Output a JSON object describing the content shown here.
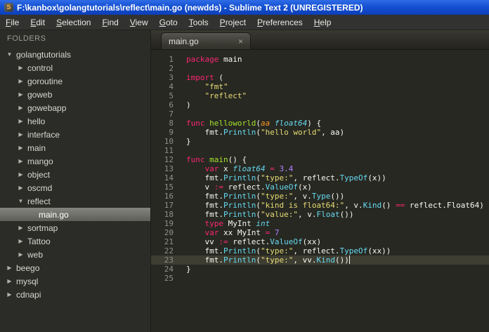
{
  "window": {
    "title": "F:\\kanbox\\golangtutorials\\reflect\\main.go (newdds) - Sublime Text 2 (UNREGISTERED)",
    "app_icon_letter": "S"
  },
  "menu": {
    "items": [
      "File",
      "Edit",
      "Selection",
      "Find",
      "View",
      "Goto",
      "Tools",
      "Project",
      "Preferences",
      "Help"
    ]
  },
  "sidebar": {
    "header": "FOLDERS",
    "items": [
      {
        "label": "golangtutorials",
        "lvl": 0,
        "kind": "folder",
        "state": "open"
      },
      {
        "label": "control",
        "lvl": 1,
        "kind": "folder",
        "state": "closed"
      },
      {
        "label": "goroutine",
        "lvl": 1,
        "kind": "folder",
        "state": "closed"
      },
      {
        "label": "goweb",
        "lvl": 1,
        "kind": "folder",
        "state": "closed"
      },
      {
        "label": "gowebapp",
        "lvl": 1,
        "kind": "folder",
        "state": "closed"
      },
      {
        "label": "hello",
        "lvl": 1,
        "kind": "folder",
        "state": "closed"
      },
      {
        "label": "interface",
        "lvl": 1,
        "kind": "folder",
        "state": "closed"
      },
      {
        "label": "main",
        "lvl": 1,
        "kind": "folder",
        "state": "closed"
      },
      {
        "label": "mango",
        "lvl": 1,
        "kind": "folder",
        "state": "closed"
      },
      {
        "label": "object",
        "lvl": 1,
        "kind": "folder",
        "state": "closed"
      },
      {
        "label": "oscmd",
        "lvl": 1,
        "kind": "folder",
        "state": "closed"
      },
      {
        "label": "reflect",
        "lvl": 1,
        "kind": "folder",
        "state": "open"
      },
      {
        "label": "main.go",
        "lvl": 2,
        "kind": "file",
        "selected": true
      },
      {
        "label": "sortmap",
        "lvl": 1,
        "kind": "folder",
        "state": "closed"
      },
      {
        "label": "Tattoo",
        "lvl": 1,
        "kind": "folder",
        "state": "closed"
      },
      {
        "label": "web",
        "lvl": 1,
        "kind": "folder",
        "state": "closed"
      },
      {
        "label": "beego",
        "lvl": 0,
        "kind": "folder",
        "state": "closed"
      },
      {
        "label": "mysql",
        "lvl": 0,
        "kind": "folder",
        "state": "closed"
      },
      {
        "label": "cdnapi",
        "lvl": 0,
        "kind": "folder",
        "state": "closed"
      }
    ]
  },
  "tabs": [
    {
      "label": "main.go",
      "close": "×",
      "active": true
    }
  ],
  "editor": {
    "lines": [
      {
        "n": 1,
        "seg": [
          [
            "keyword",
            "package"
          ],
          [
            "plain",
            " main"
          ]
        ]
      },
      {
        "n": 2,
        "seg": []
      },
      {
        "n": 3,
        "seg": [
          [
            "keyword",
            "import"
          ],
          [
            "plain",
            " ("
          ]
        ]
      },
      {
        "n": 4,
        "seg": [
          [
            "plain",
            "    "
          ],
          [
            "string",
            "\"fmt\""
          ]
        ]
      },
      {
        "n": 5,
        "seg": [
          [
            "plain",
            "    "
          ],
          [
            "string",
            "\"reflect\""
          ]
        ]
      },
      {
        "n": 6,
        "seg": [
          [
            "plain",
            ")"
          ]
        ]
      },
      {
        "n": 7,
        "seg": []
      },
      {
        "n": 8,
        "seg": [
          [
            "keyword",
            "func"
          ],
          [
            "plain",
            " "
          ],
          [
            "funcdef",
            "helloworld"
          ],
          [
            "plain",
            "("
          ],
          [
            "param",
            "aa"
          ],
          [
            "plain",
            " "
          ],
          [
            "type",
            "float64"
          ],
          [
            "plain",
            ") {"
          ]
        ]
      },
      {
        "n": 9,
        "seg": [
          [
            "plain",
            "    fmt."
          ],
          [
            "call",
            "Println"
          ],
          [
            "plain",
            "("
          ],
          [
            "string",
            "\"hello world\""
          ],
          [
            "plain",
            ", aa)"
          ]
        ]
      },
      {
        "n": 10,
        "seg": [
          [
            "plain",
            "}"
          ]
        ]
      },
      {
        "n": 11,
        "seg": []
      },
      {
        "n": 12,
        "seg": [
          [
            "keyword",
            "func"
          ],
          [
            "plain",
            " "
          ],
          [
            "funcdef",
            "main"
          ],
          [
            "plain",
            "() {"
          ]
        ]
      },
      {
        "n": 13,
        "seg": [
          [
            "plain",
            "    "
          ],
          [
            "keyword",
            "var"
          ],
          [
            "plain",
            " x "
          ],
          [
            "type",
            "float64"
          ],
          [
            "plain",
            " "
          ],
          [
            "keyword",
            "="
          ],
          [
            "plain",
            " "
          ],
          [
            "num",
            "3.4"
          ]
        ]
      },
      {
        "n": 14,
        "seg": [
          [
            "plain",
            "    fmt."
          ],
          [
            "call",
            "Println"
          ],
          [
            "plain",
            "("
          ],
          [
            "string",
            "\"type:\""
          ],
          [
            "plain",
            ", reflect."
          ],
          [
            "call",
            "TypeOf"
          ],
          [
            "plain",
            "(x))"
          ]
        ]
      },
      {
        "n": 15,
        "seg": [
          [
            "plain",
            "    v "
          ],
          [
            "keyword",
            ":="
          ],
          [
            "plain",
            " reflect."
          ],
          [
            "call",
            "ValueOf"
          ],
          [
            "plain",
            "(x)"
          ]
        ]
      },
      {
        "n": 16,
        "seg": [
          [
            "plain",
            "    fmt."
          ],
          [
            "call",
            "Println"
          ],
          [
            "plain",
            "("
          ],
          [
            "string",
            "\"type:\""
          ],
          [
            "plain",
            ", v."
          ],
          [
            "call",
            "Type"
          ],
          [
            "plain",
            "())"
          ]
        ]
      },
      {
        "n": 17,
        "seg": [
          [
            "plain",
            "    fmt."
          ],
          [
            "call",
            "Println"
          ],
          [
            "plain",
            "("
          ],
          [
            "string",
            "\"kind is float64:\""
          ],
          [
            "plain",
            ", v."
          ],
          [
            "call",
            "Kind"
          ],
          [
            "plain",
            "() "
          ],
          [
            "keyword",
            "=="
          ],
          [
            "plain",
            " reflect.Float64)"
          ]
        ]
      },
      {
        "n": 18,
        "seg": [
          [
            "plain",
            "    fmt."
          ],
          [
            "call",
            "Println"
          ],
          [
            "plain",
            "("
          ],
          [
            "string",
            "\"value:\""
          ],
          [
            "plain",
            ", v."
          ],
          [
            "call",
            "Float"
          ],
          [
            "plain",
            "())"
          ]
        ]
      },
      {
        "n": 19,
        "seg": [
          [
            "plain",
            "    "
          ],
          [
            "keyword",
            "type"
          ],
          [
            "plain",
            " MyInt "
          ],
          [
            "type",
            "int"
          ]
        ]
      },
      {
        "n": 20,
        "seg": [
          [
            "plain",
            "    "
          ],
          [
            "keyword",
            "var"
          ],
          [
            "plain",
            " xx MyInt "
          ],
          [
            "keyword",
            "="
          ],
          [
            "plain",
            " "
          ],
          [
            "num",
            "7"
          ]
        ]
      },
      {
        "n": 21,
        "seg": [
          [
            "plain",
            "    vv "
          ],
          [
            "keyword",
            ":="
          ],
          [
            "plain",
            " reflect."
          ],
          [
            "call",
            "ValueOf"
          ],
          [
            "plain",
            "(xx)"
          ]
        ]
      },
      {
        "n": 22,
        "seg": [
          [
            "plain",
            "    fmt."
          ],
          [
            "call",
            "Println"
          ],
          [
            "plain",
            "("
          ],
          [
            "string",
            "\"type:\""
          ],
          [
            "plain",
            ", reflect."
          ],
          [
            "call",
            "TypeOf"
          ],
          [
            "plain",
            "(xx))"
          ]
        ]
      },
      {
        "n": 23,
        "seg": [
          [
            "plain",
            "    fmt."
          ],
          [
            "call",
            "Println"
          ],
          [
            "plain",
            "("
          ],
          [
            "string",
            "\"type:\""
          ],
          [
            "plain",
            ", vv."
          ],
          [
            "call",
            "Kind"
          ],
          [
            "plain",
            "())"
          ]
        ],
        "cur": true,
        "caret": true
      },
      {
        "n": 24,
        "seg": [
          [
            "plain",
            "}"
          ]
        ]
      },
      {
        "n": 25,
        "seg": []
      }
    ]
  },
  "theme": {
    "titlebar_blue": "#1550d2",
    "editor_bg": "#272822",
    "sidebar_bg": "#2b2b27",
    "current_line": "#3e3d32",
    "line_number": "#8f908a",
    "keyword": "#f92672",
    "string": "#e6db74",
    "function": "#a6e22e",
    "type": "#66d9ef",
    "number": "#ae81ff",
    "param": "#fd971f",
    "plain_text": "#f8f8f2"
  }
}
